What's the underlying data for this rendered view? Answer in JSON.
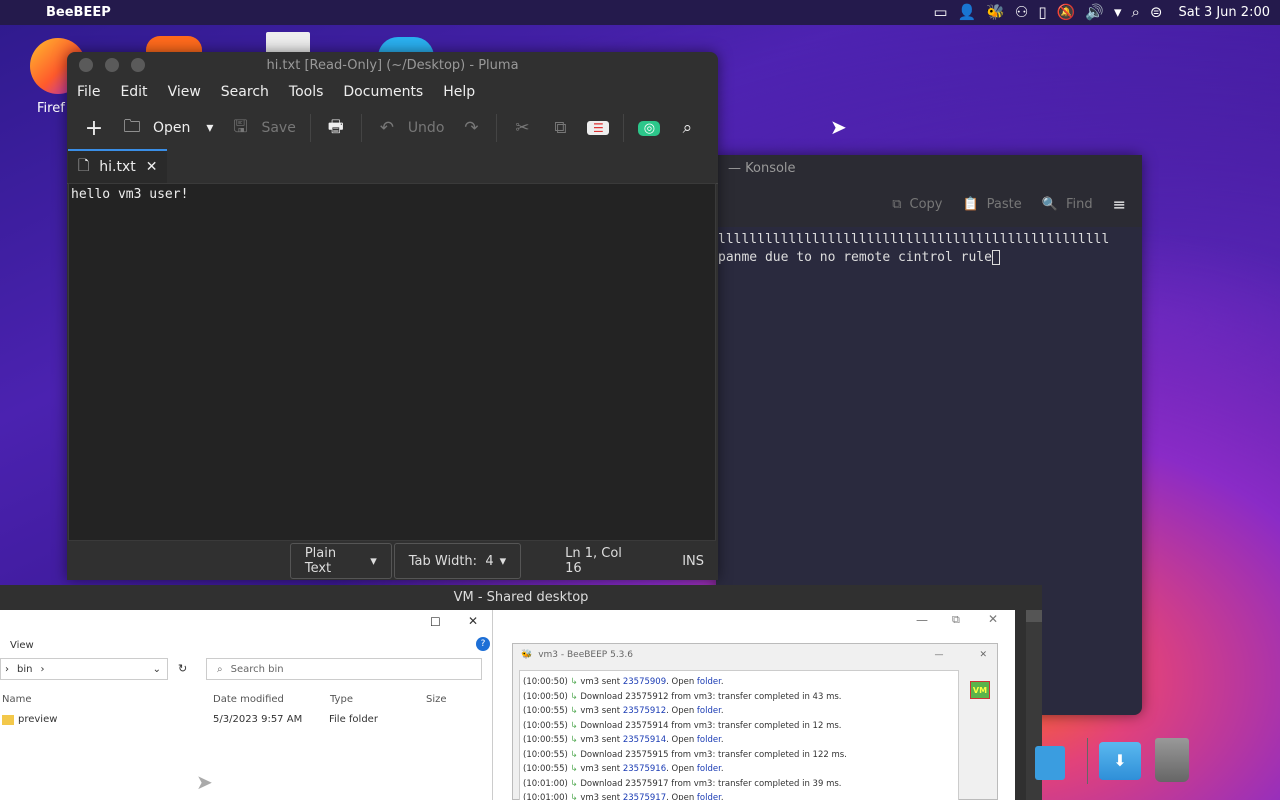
{
  "topbar": {
    "app_name": "BeeBEEP",
    "clock": "Sat 3 Jun 2:00",
    "tray_icons": [
      "battery-icon",
      "user-icon",
      "beebeep-tray-icon",
      "account-icon",
      "clipboard-icon",
      "mute-icon",
      "volume-icon",
      "menu-arrow-icon",
      "search-icon",
      "toggle-icon"
    ]
  },
  "desktop": {
    "firefox_label": "Firef"
  },
  "pluma": {
    "title": "hi.txt [Read-Only] (~/Desktop) - Pluma",
    "menu": [
      "File",
      "Edit",
      "View",
      "Search",
      "Tools",
      "Documents",
      "Help"
    ],
    "toolbar": {
      "open": "Open",
      "save": "Save",
      "undo": "Undo"
    },
    "tab": "hi.txt",
    "content": "hello vm3 user!",
    "status": {
      "language": "Plain Text",
      "tab_width": "Tab Width:  4",
      "position": "Ln 1, Col 16",
      "mode": "INS"
    }
  },
  "konsole": {
    "title": "— Konsole",
    "copy": "Copy",
    "paste": "Paste",
    "find": "Find",
    "lines": [
      "llllllllllllllllllllllllllllllllllllllllllllllllll",
      "panme due to no remote cintrol rule"
    ]
  },
  "vm": {
    "title": "VM - Shared desktop",
    "explorer": {
      "view_menu": "View",
      "path": "bin",
      "search_placeholder": "Search bin",
      "columns": [
        "Name",
        "Date modified",
        "Type",
        "Size"
      ],
      "rows": [
        {
          "name": "preview",
          "modified": "5/3/2023 9:57 AM",
          "type": "File folder",
          "size": ""
        }
      ]
    },
    "beebeep": {
      "title": "vm3 - BeeBEEP 5.3.6",
      "badge": "VM",
      "log": [
        {
          "time": "(10:00:50)",
          "pre": "vm3 sent ",
          "id": "23575909",
          "post": ". Open ",
          "link": "folder",
          "end": "."
        },
        {
          "time": "(10:00:50)",
          "pre": "Download 23575912 from vm3: transfer completed in 43 ms.",
          "id": "",
          "post": "",
          "link": "",
          "end": ""
        },
        {
          "time": "(10:00:55)",
          "pre": "vm3 sent ",
          "id": "23575912",
          "post": ". Open ",
          "link": "folder",
          "end": "."
        },
        {
          "time": "(10:00:55)",
          "pre": "Download 23575914 from vm3: transfer completed in 12 ms.",
          "id": "",
          "post": "",
          "link": "",
          "end": ""
        },
        {
          "time": "(10:00:55)",
          "pre": "vm3 sent ",
          "id": "23575914",
          "post": ". Open ",
          "link": "folder",
          "end": "."
        },
        {
          "time": "(10:00:55)",
          "pre": "Download 23575915 from vm3: transfer completed in 122 ms.",
          "id": "",
          "post": "",
          "link": "",
          "end": ""
        },
        {
          "time": "(10:00:55)",
          "pre": "vm3 sent ",
          "id": "23575916",
          "post": ". Open ",
          "link": "folder",
          "end": "."
        },
        {
          "time": "(10:01:00)",
          "pre": "Download 23575917 from vm3: transfer completed in 39 ms.",
          "id": "",
          "post": "",
          "link": "",
          "end": ""
        },
        {
          "time": "(10:01:00)",
          "pre": "vm3 sent ",
          "id": "23575917",
          "post": ". Open ",
          "link": "folder",
          "end": "."
        }
      ]
    }
  }
}
